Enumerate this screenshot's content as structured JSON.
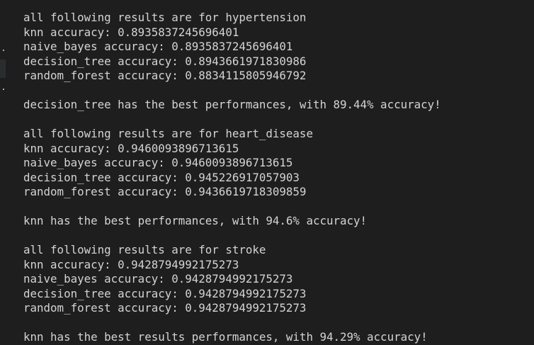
{
  "gutter": {
    "dots": [
      ".",
      "."
    ]
  },
  "output": {
    "lines": [
      "all following results are for hypertension",
      "knn accuracy: 0.8935837245696401",
      "naive_bayes accuracy: 0.8935837245696401",
      "decision_tree accuracy: 0.8943661971830986",
      "random_forest accuracy: 0.8834115805946792",
      "",
      "decision_tree has the best performances, with 89.44% accuracy!",
      "",
      "all following results are for heart_disease",
      "knn accuracy: 0.9460093896713615",
      "naive_bayes accuracy: 0.9460093896713615",
      "decision_tree accuracy: 0.945226917057903",
      "random_forest accuracy: 0.9436619718309859",
      "",
      "knn has the best performances, with 94.6% accuracy!",
      "",
      "all following results are for stroke",
      "knn accuracy: 0.9428794992175273",
      "naive_bayes accuracy: 0.9428794992175273",
      "decision_tree accuracy: 0.9428794992175273",
      "random_forest accuracy: 0.9428794992175273",
      "",
      "knn has the best results performances, with 94.29% accuracy!"
    ]
  }
}
